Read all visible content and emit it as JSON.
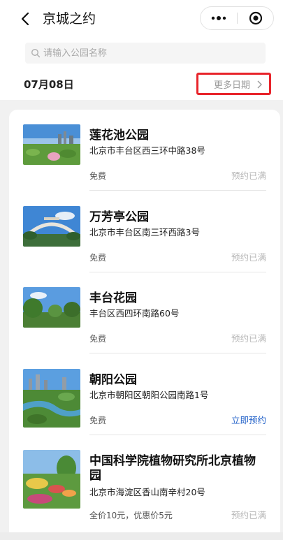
{
  "nav": {
    "title": "京城之约",
    "back_icon": "chevron-left-icon",
    "more_icon": "more-dots-icon",
    "close_icon": "target-circle-icon"
  },
  "search": {
    "placeholder": "请输入公园名称",
    "value": ""
  },
  "date_bar": {
    "current_date": "07月08日",
    "more_dates_label": "更多日期"
  },
  "colors": {
    "highlight_border": "#e8242b",
    "link_blue": "#2563c9",
    "muted_status": "#b7b7b7"
  },
  "parks": [
    {
      "name": "莲花池公园",
      "address": "北京市丰台区西三环中路38号",
      "price": "免费",
      "status": "预约已满",
      "available": false
    },
    {
      "name": "万芳亭公园",
      "address": "北京市丰台区南三环西路3号",
      "price": "免费",
      "status": "预约已满",
      "available": false
    },
    {
      "name": "丰台花园",
      "address": "丰台区西四环南路60号",
      "price": "免费",
      "status": "预约已满",
      "available": false
    },
    {
      "name": "朝阳公园",
      "address": "北京市朝阳区朝阳公园南路1号",
      "price": "免费",
      "status": "立即预约",
      "available": true
    },
    {
      "name": "中国科学院植物研究所北京植物园",
      "address": "北京市海淀区香山南辛村20号",
      "price": "全价10元，优惠价5元",
      "status": "预约已满",
      "available": false
    }
  ]
}
